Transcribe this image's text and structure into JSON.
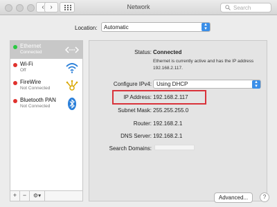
{
  "window": {
    "title": "Network",
    "search_placeholder": "Search"
  },
  "location": {
    "label": "Location:",
    "value": "Automatic"
  },
  "sidebar": {
    "items": [
      {
        "name": "Ethernet",
        "status": "Connected",
        "dot_color": "#29c940",
        "icon": "ethernet-arrows-icon",
        "selected": true
      },
      {
        "name": "Wi-Fi",
        "status": "Off",
        "dot_color": "#e0312d",
        "icon": "wifi-icon"
      },
      {
        "name": "FireWire",
        "status": "Not Connected",
        "dot_color": "#e0312d",
        "icon": "firewire-icon"
      },
      {
        "name": "Bluetooth PAN",
        "status": "Not Connected",
        "dot_color": "#e0312d",
        "icon": "bluetooth-icon"
      }
    ],
    "bottom": {
      "add": "+",
      "remove": "−",
      "gear": "⚙▾"
    }
  },
  "detail": {
    "status_label": "Status:",
    "status_value": "Connected",
    "status_desc": "Ethernet is currently active and has the IP address 192.168.2.117.",
    "configure_label": "Configure IPv4:",
    "configure_value": "Using DHCP",
    "ip_label": "IP Address:",
    "ip_value": "192.168.2.117",
    "subnet_label": "Subnet Mask:",
    "subnet_value": "255.255.255.0",
    "router_label": "Router:",
    "router_value": "192.168.2.1",
    "dns_label": "DNS Server:",
    "dns_value": "192.168.2.1",
    "search_domains_label": "Search Domains:",
    "advanced_button": "Advanced...",
    "help_button": "?"
  },
  "colors": {
    "highlight": "#d9323a",
    "accent": "#3a8ee8",
    "green": "#29c940",
    "red": "#e0312d",
    "bluetooth": "#2a7fd9",
    "wifi": "#2a7fd9",
    "firewire": "#d9a700"
  }
}
